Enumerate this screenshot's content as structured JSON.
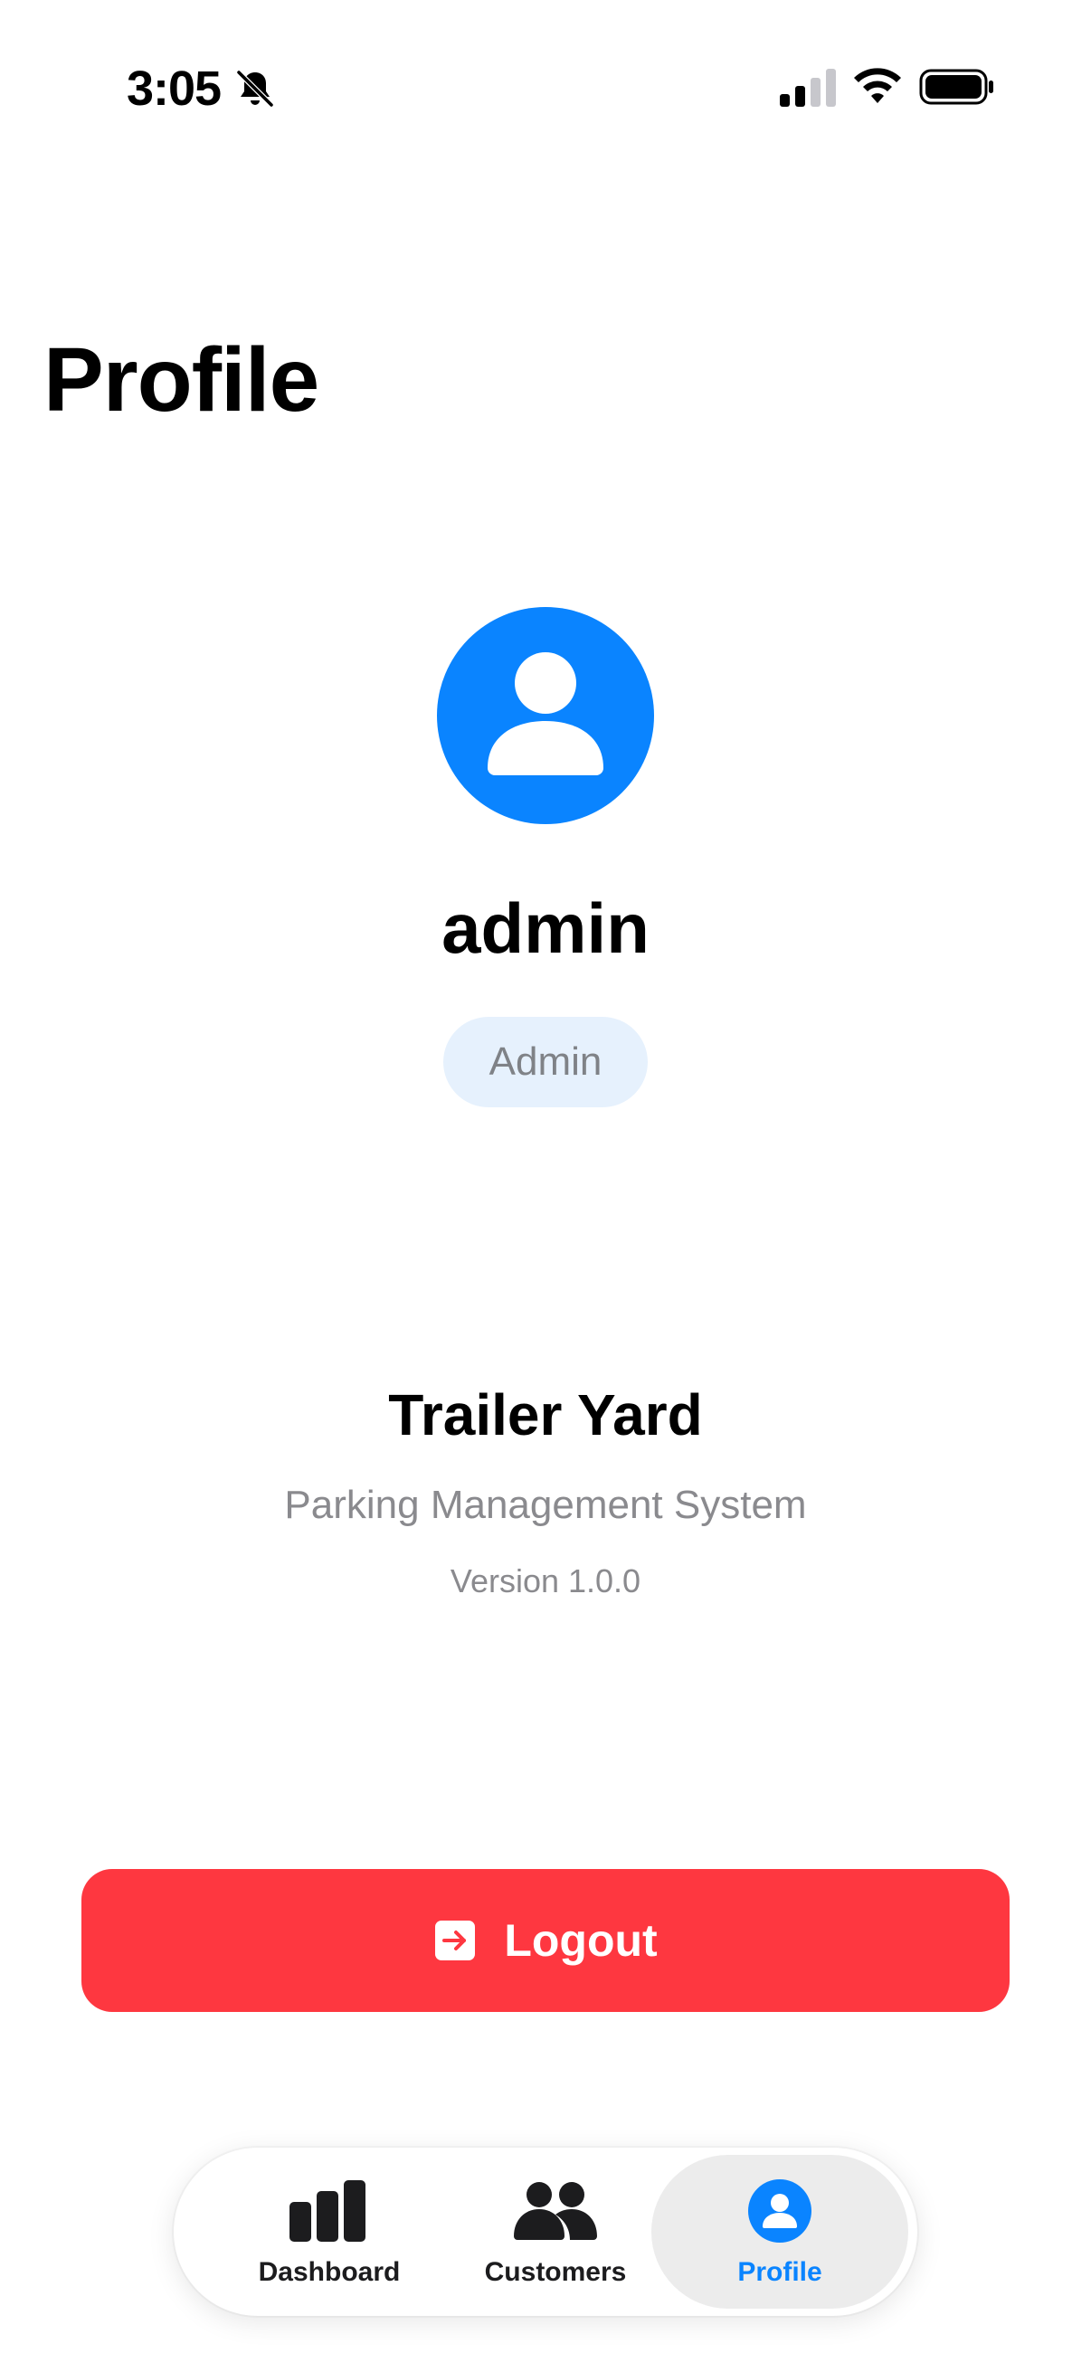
{
  "status_bar": {
    "time": "3:05",
    "icons": [
      "bell-slash-icon",
      "signal-icon",
      "wifi-icon",
      "battery-icon"
    ]
  },
  "page": {
    "title": "Profile"
  },
  "profile": {
    "avatar_icon": "person-icon",
    "username": "admin",
    "role": "Admin"
  },
  "app_info": {
    "name": "Trailer Yard",
    "subtitle": "Parking Management System",
    "version": "Version 1.0.0"
  },
  "logout": {
    "label": "Logout",
    "icon": "logout-icon"
  },
  "tab_bar": {
    "items": [
      {
        "label": "Dashboard",
        "icon": "bar-chart-icon",
        "active": false
      },
      {
        "label": "Customers",
        "icon": "people-icon",
        "active": false
      },
      {
        "label": "Profile",
        "icon": "person-circle-icon",
        "active": true
      }
    ]
  },
  "colors": {
    "accent": "#0a84ff",
    "logout": "#fe3740",
    "badge_bg": "#e6f1fd",
    "secondary_text": "#8a8a8e",
    "active_tab_bg": "#ececec"
  }
}
